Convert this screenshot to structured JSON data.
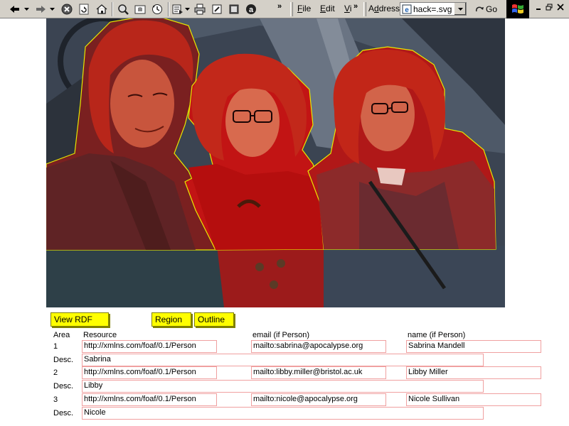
{
  "toolbar": {
    "menus": [
      {
        "label": "File",
        "accel": "F",
        "rest": "ile"
      },
      {
        "label": "Edit",
        "accel": "E",
        "rest": "dit"
      },
      {
        "label": "Vi",
        "accel": "V",
        "rest": "i"
      }
    ],
    "chevron": "»",
    "address_label": "Address",
    "address_accel": "d",
    "address_value": "hack=.svg",
    "go_label": "Go"
  },
  "buttons": {
    "view_rdf": "View RDF",
    "region": "Region",
    "outline": "Outline"
  },
  "table": {
    "headers": {
      "area": "Area",
      "resource": "Resource",
      "email": "email (if Person)",
      "name": "name (if Person)"
    },
    "desc_label": "Desc.",
    "rows": [
      {
        "area": "1",
        "resource": "http://xmlns.com/foaf/0.1/Person",
        "email": "mailto:sabrina@apocalypse.org",
        "name": "Sabrina Mandell",
        "desc": "Sabrina"
      },
      {
        "area": "2",
        "resource": "http://xmlns.com/foaf/0.1/Person",
        "email": "mailto:libby.miller@bristol.ac.uk",
        "name": "Libby Miller",
        "desc": "Libby"
      },
      {
        "area": "3",
        "resource": "http://xmlns.com/foaf/0.1/Person",
        "email": "mailto:nicole@apocalypse.org",
        "name": "Nicole Sullivan",
        "desc": "Nicole"
      }
    ]
  },
  "colors": {
    "region_fill": "#e01010",
    "region_outline": "#e8e800",
    "button_yellow": "#ffff00",
    "field_border": "#f0a0a0"
  }
}
